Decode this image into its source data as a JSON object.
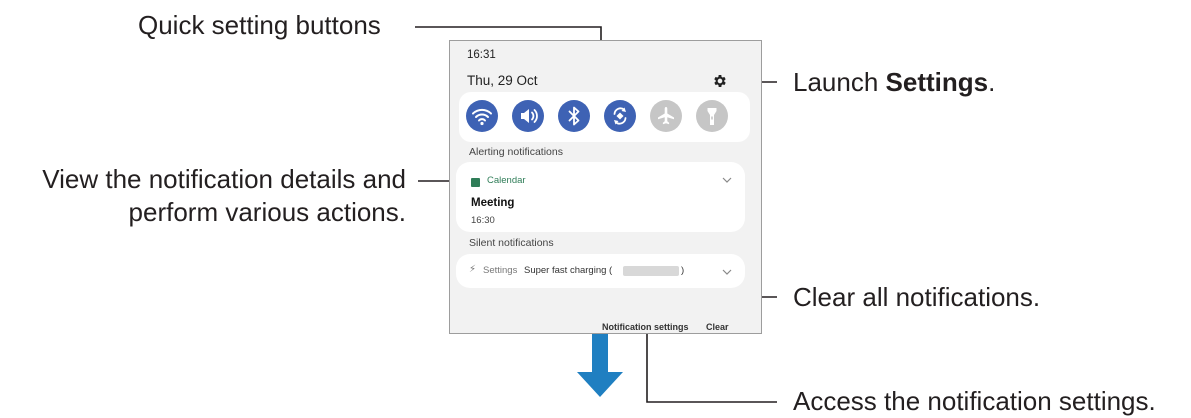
{
  "callouts": {
    "quick_settings": "Quick setting buttons",
    "launch_prefix": "Launch ",
    "launch_bold": "Settings",
    "launch_suffix": ".",
    "view_details_line1": "View the notification details and",
    "view_details_line2": "perform various actions.",
    "clear_all": "Clear all notifications.",
    "access_settings": "Access the notification settings."
  },
  "panel": {
    "time": "16:31",
    "date": "Thu, 29 Oct",
    "quick_buttons": [
      {
        "icon": "wifi-icon",
        "state": "on"
      },
      {
        "icon": "sound-icon",
        "state": "on"
      },
      {
        "icon": "bluetooth-icon",
        "state": "on"
      },
      {
        "icon": "auto-rotate-icon",
        "state": "on"
      },
      {
        "icon": "airplane-mode-icon",
        "state": "off"
      },
      {
        "icon": "flashlight-icon",
        "state": "off"
      }
    ],
    "alerting_label": "Alerting notifications",
    "calendar": {
      "app": "Calendar",
      "title": "Meeting",
      "time": "16:30"
    },
    "silent_label": "Silent notifications",
    "settings_notification": {
      "bolt": "⚡",
      "app": "Settings",
      "text": "Super fast charging (",
      "close_paren": ")"
    },
    "notification_settings_label": "Notification settings",
    "clear_label": "Clear"
  },
  "colors": {
    "accent": "#3e62b4",
    "button_off": "#c6c6c6",
    "calendar_green": "#2f7d58",
    "scroll_arrow": "#1f7fc1"
  }
}
